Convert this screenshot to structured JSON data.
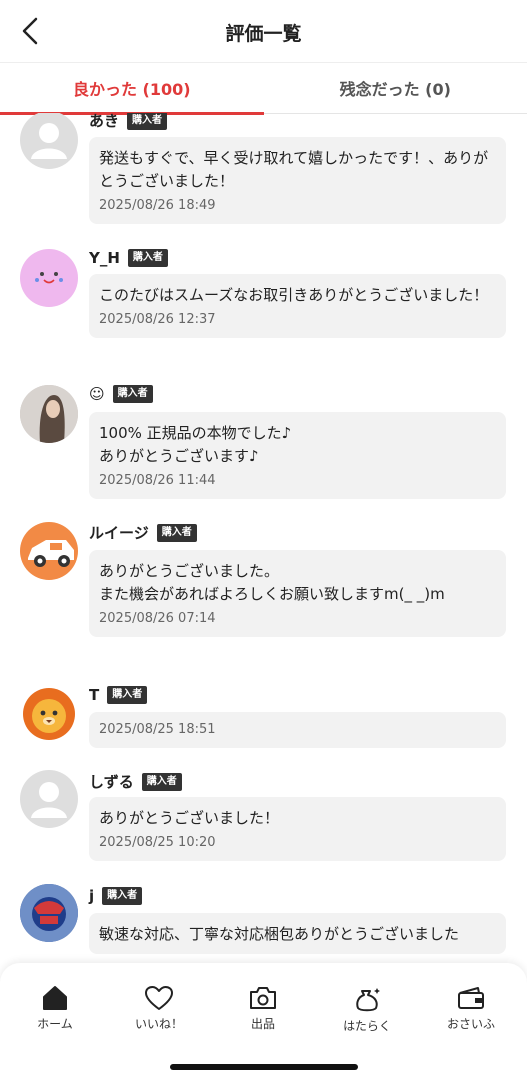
{
  "header": {
    "title": "評価一覧"
  },
  "tabs": [
    {
      "label": "良かった (100)",
      "active": true
    },
    {
      "label": "残念だった (0)",
      "active": false
    }
  ],
  "reviews": [
    {
      "name": "あき",
      "badge": "購入者",
      "message": "発送もすぐで、早く受け取れて嬉しかったです！、ありがとうございました！",
      "time": "2025/08/26 18:49",
      "avatar": "default-avatar-icon"
    },
    {
      "name": "Y_H",
      "badge": "購入者",
      "message": "このたびはスムーズなお取引きありがとうございました！",
      "time": "2025/08/26 12:37",
      "avatar": "pink-face-avatar"
    },
    {
      "name": "☺︎",
      "badge": "購入者",
      "message": "100% 正規品の本物でした♪\nありがとうございます♪",
      "time": "2025/08/26 11:44",
      "avatar": "photo-avatar"
    },
    {
      "name": "ルイージ",
      "badge": "購入者",
      "message": "ありがとうございました。\nまた機会があればよろしくお願い致しますm(_ _)m",
      "time": "2025/08/26 07:14",
      "avatar": "car-avatar"
    },
    {
      "name": "T",
      "badge": "購入者",
      "message": "",
      "time": "2025/08/25 18:51",
      "avatar": "lion-avatar"
    },
    {
      "name": "しずる",
      "badge": "購入者",
      "message": "ありがとうございました！",
      "time": "2025/08/25 10:20",
      "avatar": "default-avatar-icon"
    },
    {
      "name": "j",
      "badge": "購入者",
      "message": "敏速な対応、丁寧な対応梱包ありがとうございました",
      "time": "",
      "avatar": "figure-avatar"
    }
  ],
  "bottom_nav": [
    {
      "label": "ホーム",
      "icon": "home-icon"
    },
    {
      "label": "いいね！",
      "icon": "heart-icon"
    },
    {
      "label": "出品",
      "icon": "camera-icon"
    },
    {
      "label": "はたらく",
      "icon": "money-bag-icon"
    },
    {
      "label": "おさいふ",
      "icon": "wallet-icon"
    }
  ],
  "colors": {
    "accent": "#e03a3a",
    "bubble": "#f2f2f2",
    "badge": "#333333"
  }
}
